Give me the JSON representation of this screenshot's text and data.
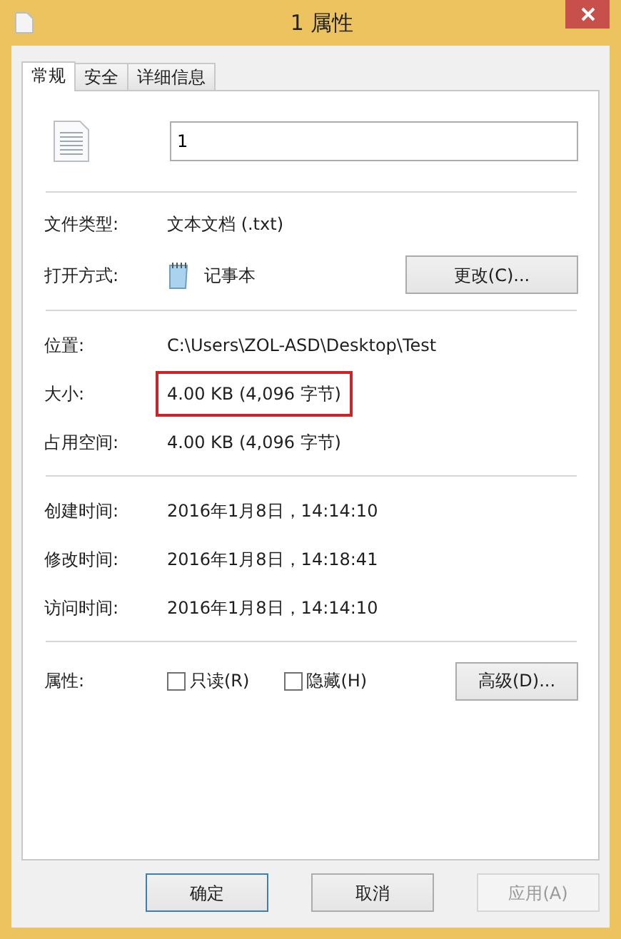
{
  "window": {
    "title": "1 属性"
  },
  "tabs": [
    {
      "label": "常规",
      "selected": true
    },
    {
      "label": "安全",
      "selected": false
    },
    {
      "label": "详细信息",
      "selected": false
    }
  ],
  "file_name": {
    "value": "1"
  },
  "sections": [
    {
      "rows": [
        {
          "kind": "text",
          "label": "文件类型:",
          "value": "文本文档 (.txt)",
          "highlighted": false
        },
        {
          "kind": "app",
          "label": "打开方式:",
          "value": "记事本",
          "button": "更改(C)..."
        }
      ]
    },
    {
      "rows": [
        {
          "kind": "text",
          "label": "位置:",
          "value": "C:\\Users\\ZOL-ASD\\Desktop\\Test",
          "highlighted": false
        },
        {
          "kind": "text",
          "label": "大小:",
          "value": "4.00 KB (4,096 字节)",
          "highlighted": true
        },
        {
          "kind": "text",
          "label": "占用空间:",
          "value": "4.00 KB (4,096 字节)",
          "highlighted": false
        }
      ]
    },
    {
      "rows": [
        {
          "kind": "text",
          "label": "创建时间:",
          "value": "2016年1月8日，14:14:10",
          "highlighted": false
        },
        {
          "kind": "text",
          "label": "修改时间:",
          "value": "2016年1月8日，14:18:41",
          "highlighted": false
        },
        {
          "kind": "text",
          "label": "访问时间:",
          "value": "2016年1月8日，14:14:10",
          "highlighted": false
        }
      ]
    },
    {
      "rows": [
        {
          "kind": "attributes",
          "label": "属性:",
          "checkboxes": [
            {
              "label": "只读(R)",
              "checked": false
            },
            {
              "label": "隐藏(H)",
              "checked": false
            }
          ],
          "button": "高级(D)..."
        }
      ]
    }
  ],
  "buttons": [
    {
      "label": "确定",
      "default": true,
      "disabled": false
    },
    {
      "label": "取消",
      "default": false,
      "disabled": false
    },
    {
      "label": "应用(A)",
      "default": false,
      "disabled": true
    }
  ]
}
